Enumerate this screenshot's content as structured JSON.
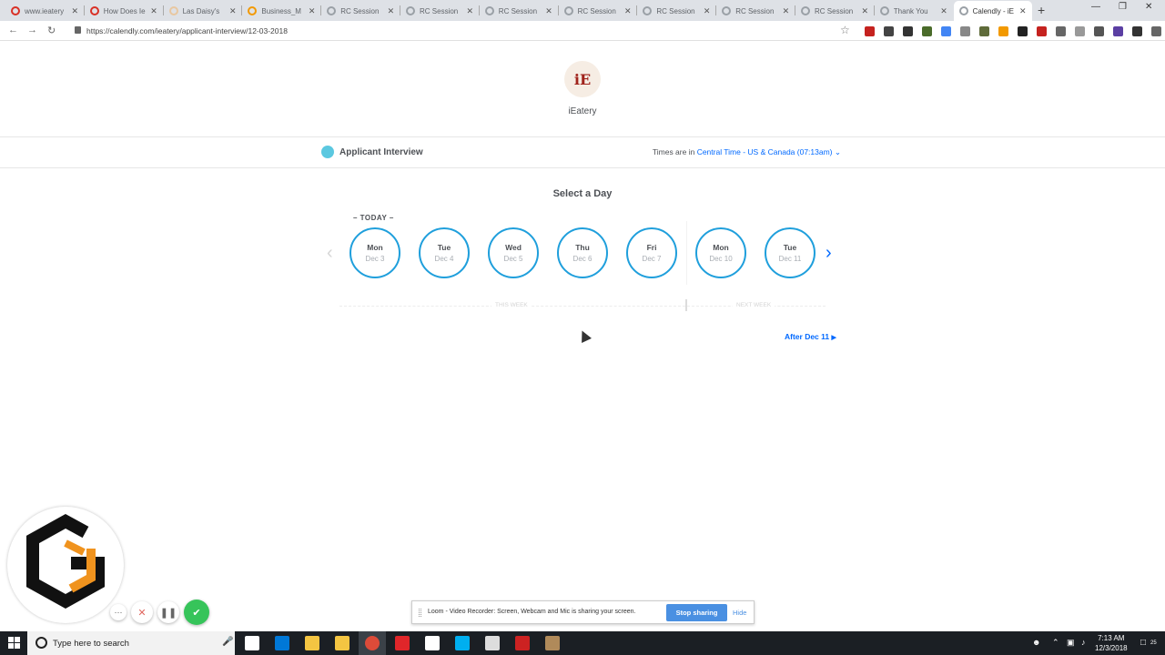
{
  "browser": {
    "tabs": [
      {
        "title": "www.ieatery",
        "favicon_color": "#d93025"
      },
      {
        "title": "How Does Ie",
        "favicon_color": "#d93025"
      },
      {
        "title": "Las Daisy's",
        "favicon_color": "#e8c7a0"
      },
      {
        "title": "Business_M",
        "favicon_color": "#f29900"
      },
      {
        "title": "RC Session",
        "favicon_color": "#9aa0a6"
      },
      {
        "title": "RC Session",
        "favicon_color": "#9aa0a6"
      },
      {
        "title": "RC Session",
        "favicon_color": "#9aa0a6"
      },
      {
        "title": "RC Session",
        "favicon_color": "#9aa0a6"
      },
      {
        "title": "RC Session",
        "favicon_color": "#9aa0a6"
      },
      {
        "title": "RC Session",
        "favicon_color": "#9aa0a6"
      },
      {
        "title": "RC Session",
        "favicon_color": "#9aa0a6"
      },
      {
        "title": "Thank You",
        "favicon_color": "#9aa0a6"
      },
      {
        "title": "Calendly - iE",
        "favicon_color": "#9aa0a6",
        "active": true
      }
    ],
    "url": "https://calendly.com/ieatery/applicant-interview/12-03-2018",
    "extension_icons": [
      "#c5221f",
      "#444444",
      "#333333",
      "#4a6b2a",
      "#4285f4",
      "#888888",
      "#5f6b3a",
      "#f29900",
      "#222222",
      "#c5221f",
      "#666666",
      "#999999",
      "#555555",
      "#5b3fa3",
      "#333333",
      "#666666"
    ]
  },
  "page": {
    "logo_text": "iE",
    "company_name": "iEatery",
    "event_name": "Applicant Interview",
    "event_color": "#5bc8e0",
    "timezone_prefix": "Times are in ",
    "timezone_link": "Central Time - US & Canada (07:13am)",
    "select_day_title": "Select a Day",
    "today_label": "– TODAY –",
    "days": [
      {
        "name": "Mon",
        "date": "Dec 3"
      },
      {
        "name": "Tue",
        "date": "Dec 4"
      },
      {
        "name": "Wed",
        "date": "Dec 5"
      },
      {
        "name": "Thu",
        "date": "Dec 6"
      },
      {
        "name": "Fri",
        "date": "Dec 7"
      },
      {
        "name": "Mon",
        "date": "Dec 10"
      },
      {
        "name": "Tue",
        "date": "Dec 11"
      }
    ],
    "this_week_label": "THIS WEEK",
    "next_week_label": "NEXT WEEK",
    "after_link": "After Dec 11",
    "accent_color": "#0069ff",
    "ring_color": "#1f9fdc"
  },
  "loom": {
    "share_text": "Loom - Video Recorder: Screen, Webcam and Mic is sharing your screen.",
    "stop_label": "Stop sharing",
    "hide_label": "Hide",
    "logo_letter": "G"
  },
  "taskbar": {
    "search_placeholder": "Type here to search",
    "clock_time": "7:13 AM",
    "clock_date": "12/3/2018",
    "notification_count": "25",
    "app_icon_colors": [
      "#ffffff",
      "#0078d7",
      "#f4c542",
      "#f4c542",
      "#dd4b39",
      "#e0262a",
      "#ffffff",
      "#00aff0",
      "#dddddd",
      "#cc2222",
      "#b08a5a"
    ]
  }
}
